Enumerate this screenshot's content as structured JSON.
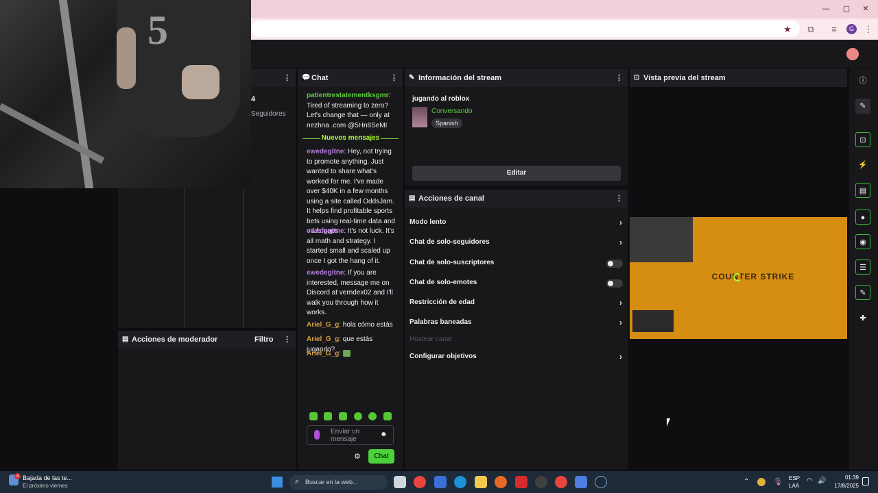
{
  "browser": {
    "window_controls": {
      "minimize": "—",
      "maximize": "▢",
      "close": "✕"
    }
  },
  "webcam": {
    "jersey_number": "5"
  },
  "left_panel": {
    "count": "4",
    "count_label": "Seguidores"
  },
  "chat": {
    "title": "Chat",
    "messages_before": [
      {
        "user": "patientrestatementksgmr",
        "text": ": Tired of streaming to zero? Let's change that — only at nezhna .com @5Hn8SeMI"
      }
    ],
    "new_messages_label": "Nuevos mensajes",
    "messages_after": [
      {
        "user": "ewedegitne",
        "text": ": Hey, not trying to promote anything. Just wanted to share what's worked for me. I've made over $40K in a few months using a site called OddsJam. It helps find profitable sports bets using real-time data and odds gaps."
      },
      {
        "user": "ewedegitne",
        "text": ": It's not luck. It's all math and strategy. I started small and scaled up once I got the hang of it."
      },
      {
        "user": "ewedegitne",
        "text": ": If you are interested, message me on Discord at verndex02 and I'll walk you through how it works."
      },
      {
        "user": "Ariel_G_g",
        "text": ": hola cómo estás"
      },
      {
        "user": "Ariel_G_g",
        "text": ": que estás jugando?"
      },
      {
        "user": "Ariel_G_g",
        "text": ":"
      }
    ],
    "input_placeholder": "Enviar un mensaje",
    "send_label": "Chat"
  },
  "moderator": {
    "title": "Acciones de moderador",
    "filter_label": "Filtro"
  },
  "stream_info": {
    "title": "Información del stream",
    "stream_title": "jugando al roblox",
    "category": "Conversando",
    "tag": "Spanish",
    "edit_label": "Editar"
  },
  "channel_actions": {
    "title": "Acciones de canal",
    "rows": [
      {
        "label": "Modo lento",
        "control": "chevron"
      },
      {
        "label": "Chat de solo-seguidores",
        "control": "chevron"
      },
      {
        "label": "Chat de solo-suscriptores",
        "control": "toggle"
      },
      {
        "label": "Chat de solo-emotes",
        "control": "toggle"
      },
      {
        "label": "Restricción de edad",
        "control": "chevron"
      },
      {
        "label": "Palabras baneadas",
        "control": "chevron"
      },
      {
        "label": "Hostear canal",
        "control": "disabled"
      },
      {
        "label": "Configurar objetivos",
        "control": "chevron"
      }
    ]
  },
  "preview": {
    "title": "Vista previa del stream",
    "game_logo_text": "COUNTER STRIKE"
  },
  "taskbar": {
    "notification_title": "Bajada de las te...",
    "notification_sub": "El próximo viernes",
    "notification_badge": "4",
    "search_placeholder": "Buscar en la web...",
    "lang_top": "ESP",
    "lang_bottom": "LAA",
    "time": "01:39",
    "date": "17/8/2025"
  },
  "colors": {
    "accent_green": "#4bd23a",
    "panel_bg": "#18181b",
    "header_bg": "#1f1f23",
    "taskbar_bg": "#1e2a38",
    "preview_orange": "#d58d12"
  }
}
